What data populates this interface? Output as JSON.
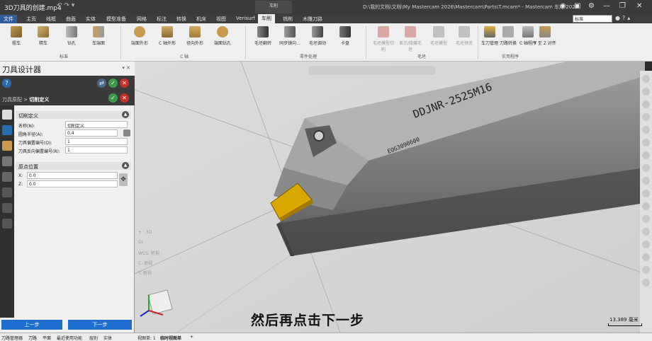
{
  "titlebar": {
    "video_title": "3D刀具的创建.mp4",
    "quick_access": "↶ ↷ ▾",
    "context_tab": "车削",
    "path": "D:\\我的文档\\文档\\My Mastercam 2026\\Mastercam\\Parts\\T.mcam* - Mastercam 车床 2026"
  },
  "menu": {
    "tabs": [
      "文件",
      "主页",
      "线框",
      "曲面",
      "实体",
      "模型准备",
      "网格",
      "标注",
      "转换",
      "机床",
      "视图",
      "Verisurf",
      "车削",
      "铣削",
      "木雕刀路"
    ],
    "active_tab": "车削",
    "view_select": "标准"
  },
  "ribbon": {
    "buttons": [
      {
        "label": "粗车",
        "disabled": false
      },
      {
        "label": "精车",
        "disabled": false
      },
      {
        "label": "钻孔",
        "disabled": false
      },
      {
        "label": "车端面",
        "disabled": false
      },
      {
        "label": "端面外形",
        "disabled": false
      },
      {
        "label": "C 轴外形",
        "disabled": false
      },
      {
        "label": "径向外形",
        "disabled": false
      },
      {
        "label": "端面钻孔",
        "disabled": false
      },
      {
        "label": "毛坯翻转",
        "disabled": false
      },
      {
        "label": "同步镜向...",
        "disabled": false
      },
      {
        "label": "毛坯调动",
        "disabled": false
      },
      {
        "label": "卡盘",
        "disabled": false
      },
      {
        "label": "毛坯模型切削",
        "disabled": true
      },
      {
        "label": "显示/隐藏毛坯",
        "disabled": true
      },
      {
        "label": "毛坯模型",
        "disabled": true
      },
      {
        "label": "毛坯预览",
        "disabled": true
      },
      {
        "label": "车刀管理",
        "disabled": false
      },
      {
        "label": "刀路转换",
        "disabled": false
      },
      {
        "label": "C 轴程序",
        "disabled": false
      },
      {
        "label": "Y 至 Z 对齐",
        "disabled": false
      }
    ],
    "groups": [
      "标准",
      "C 轴",
      "零件处理",
      "毛坯",
      "实用程序"
    ]
  },
  "panel": {
    "title": "刀具设计器",
    "breadcrumb_prefix": "刀具原配 >",
    "breadcrumb_current": "切削定义",
    "section1": "切削定义",
    "fields": [
      {
        "label": "名称(N):",
        "value": "切削定义"
      },
      {
        "label": "圆角半径(A):",
        "value": "0.4"
      },
      {
        "label": "刀具偏置编号(O):",
        "value": "1"
      },
      {
        "label": "刀具反向偏置编号(R):",
        "value": "1"
      }
    ],
    "section2": "原点位置",
    "x_label": "X:",
    "x_value": "0.0",
    "z_label": "Z:",
    "z_value": "0.0",
    "prev_button": "上一步",
    "next_button": "下一步"
  },
  "viewport": {
    "tool_text_main": "DDJNR-2525M16",
    "tool_text_small": "EOG3090600",
    "subtitle": "然后再点击下一步",
    "scale": "13.389 毫米"
  },
  "statusbar": {
    "left_tabs": [
      "刀路管理器",
      "刀路",
      "平面",
      "最近使用功能",
      "层别",
      "实体"
    ],
    "view_tabs": [
      "视图单: 1",
      "临时视图单"
    ]
  },
  "colors": {
    "accent_blue": "#1f6fd1",
    "insert_yellow": "#d9a800",
    "ok_green": "#3c9a4a",
    "cancel_red": "#c9302c"
  }
}
